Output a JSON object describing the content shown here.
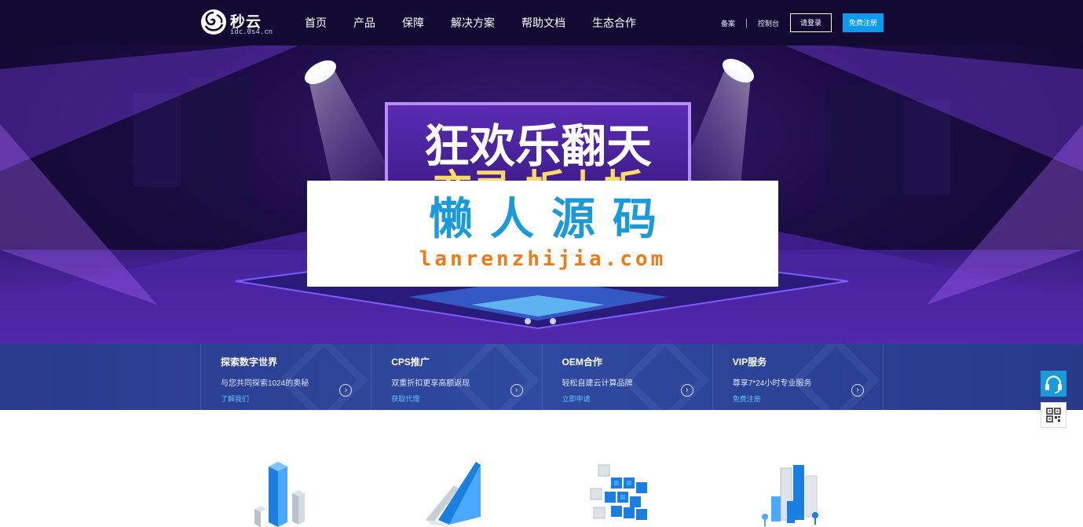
{
  "header": {
    "logo": {
      "title": "秒云",
      "subtitle": "idc.0s4.cn",
      "icon": "logo-swirl-icon"
    },
    "nav": [
      "首页",
      "产品",
      "保障",
      "解决方案",
      "帮助文档",
      "生态合作"
    ],
    "links": {
      "record": "备案",
      "console": "控制台"
    },
    "login_label": "请登录",
    "register_label": "免费注册"
  },
  "hero": {
    "slide_count": 2,
    "active_slide": 1,
    "banner_text_line1": "狂欢乐翻天",
    "banner_text_line2": "亦忌 折上折"
  },
  "watermark": {
    "title": "懒人源码",
    "url": "lanrenzhijia.com"
  },
  "features": [
    {
      "title": "探索数字世界",
      "desc": "与您共同探索1024的奥秘",
      "link": "了解我们"
    },
    {
      "title": "CPS推广",
      "desc": "双重折扣更享高额返现",
      "link": "获取代理"
    },
    {
      "title": "OEM合作",
      "desc": "轻松自建云计算品牌",
      "link": "立即申请"
    },
    {
      "title": "VIP服务",
      "desc": "尊享7*24小时专业服务",
      "link": "免费注册"
    }
  ],
  "float_tools": {
    "service_icon": "headset-icon",
    "qr_icon": "qr-code-icon"
  },
  "products_icons": [
    "bar-blocks-icon",
    "ramp-icon",
    "cube-grid-icon",
    "city-blocks-icon"
  ],
  "colors": {
    "nav_bg": "#130a34",
    "accent": "#0a9cf2",
    "strip_bg": "#2f4aa0",
    "watermark_blue": "#1a9ad9",
    "watermark_orange": "#f07a15"
  }
}
